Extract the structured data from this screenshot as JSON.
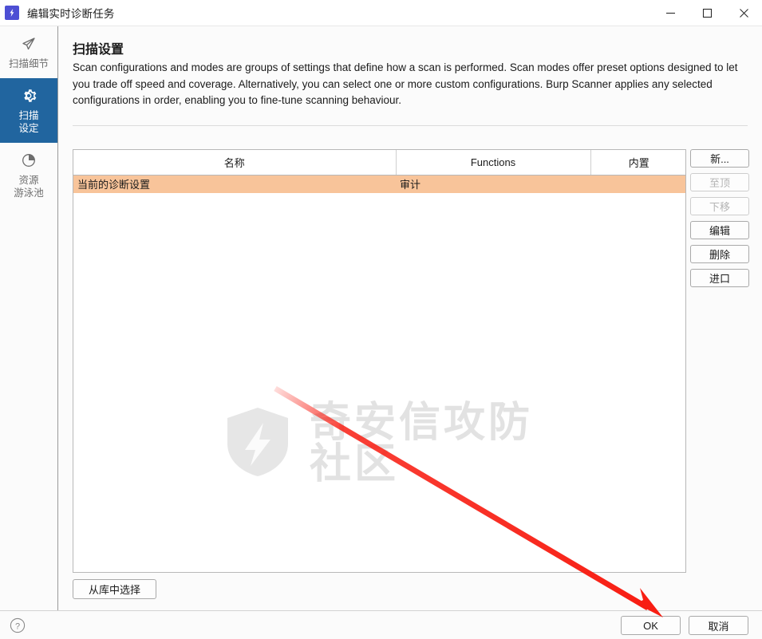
{
  "window": {
    "title": "编辑实时诊断任务",
    "app_icon": "lightning-bolt-icon",
    "controls": {
      "minimize": "minimize-icon",
      "maximize": "maximize-icon",
      "close": "close-icon"
    }
  },
  "sidebar": {
    "items": [
      {
        "label": "扫描细节",
        "icon": "scan-details-icon",
        "active": false
      },
      {
        "label": "扫描\n设定",
        "icon": "gear-icon",
        "active": true
      },
      {
        "label": "资源\n游泳池",
        "icon": "pie-chart-icon",
        "active": false
      }
    ]
  },
  "main": {
    "title": "扫描设置",
    "description": "Scan configurations and modes are groups of settings that define how a scan is performed. Scan modes offer preset options designed to let you trade off speed and coverage. Alternatively, you can select one or more custom configurations. Burp Scanner applies any selected configurations in order, enabling you to fine-tune scanning behaviour.",
    "table": {
      "columns": [
        "名称",
        "Functions",
        "内置"
      ],
      "rows": [
        {
          "name": "当前的诊断设置",
          "functions": "审计",
          "builtin": "",
          "selected": true
        }
      ]
    },
    "side_buttons": [
      {
        "label": "新...",
        "enabled": true
      },
      {
        "label": "至顶",
        "enabled": false
      },
      {
        "label": "下移",
        "enabled": false
      },
      {
        "label": "编辑",
        "enabled": true
      },
      {
        "label": "删除",
        "enabled": true
      },
      {
        "label": "进口",
        "enabled": true
      }
    ],
    "library_button": "从库中选择",
    "watermark": {
      "text": "奇安信攻防社区",
      "icon": "shield-bolt-icon",
      "color": "#e2e2e2"
    }
  },
  "footer": {
    "help_icon": "question-mark-icon",
    "ok_button": "OK",
    "cancel_button": "取消"
  },
  "annotation": {
    "arrow_color": "#f81e13",
    "target": "ok-button"
  },
  "colors": {
    "accent_blue": "#21659f",
    "selection_orange": "#f8c49a",
    "app_icon_purple": "#4d4fd4"
  }
}
